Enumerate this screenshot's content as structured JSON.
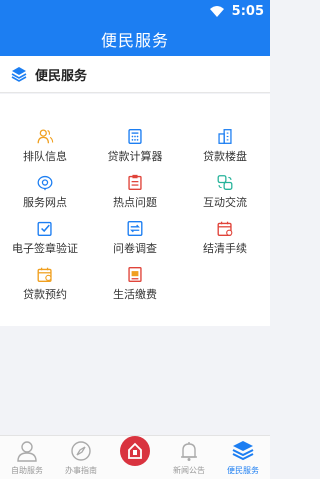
{
  "status": {
    "time": "5:05"
  },
  "header": {
    "title": "便民服务"
  },
  "section": {
    "title": "便民服务"
  },
  "services": [
    {
      "label": "排队信息",
      "icon": "queue-people-icon",
      "color": "#f0a020"
    },
    {
      "label": "贷款计算器",
      "icon": "calculator-icon",
      "color": "#1c7ef2"
    },
    {
      "label": "贷款楼盘",
      "icon": "building-icon",
      "color": "#1c7ef2"
    },
    {
      "label": "服务网点",
      "icon": "location-pin-icon",
      "color": "#1c7ef2"
    },
    {
      "label": "热点问题",
      "icon": "clipboard-icon",
      "color": "#e0443a"
    },
    {
      "label": "互动交流",
      "icon": "chat-exchange-icon",
      "color": "#26b39a"
    },
    {
      "label": "电子签章验证",
      "icon": "checkbox-signature-icon",
      "color": "#1c7ef2"
    },
    {
      "label": "问卷调查",
      "icon": "survey-icon",
      "color": "#1c7ef2"
    },
    {
      "label": "结清手续",
      "icon": "calendar-settle-icon",
      "color": "#e0443a"
    },
    {
      "label": "贷款预约",
      "icon": "calendar-appointment-icon",
      "color": "#f0a020"
    },
    {
      "label": "生活缴费",
      "icon": "bill-payment-icon",
      "color": "#e0443a"
    }
  ],
  "tabs": [
    {
      "label": "自助服务",
      "icon": "person-icon",
      "active": false
    },
    {
      "label": "办事指南",
      "icon": "compass-icon",
      "active": false
    },
    {
      "label": "",
      "icon": "home-logo-icon",
      "active": false
    },
    {
      "label": "新闻公告",
      "icon": "bell-icon",
      "active": false
    },
    {
      "label": "便民服务",
      "icon": "layers-icon",
      "active": true
    }
  ],
  "colors": {
    "primary": "#1c7ef2",
    "center": "#d9333f"
  }
}
